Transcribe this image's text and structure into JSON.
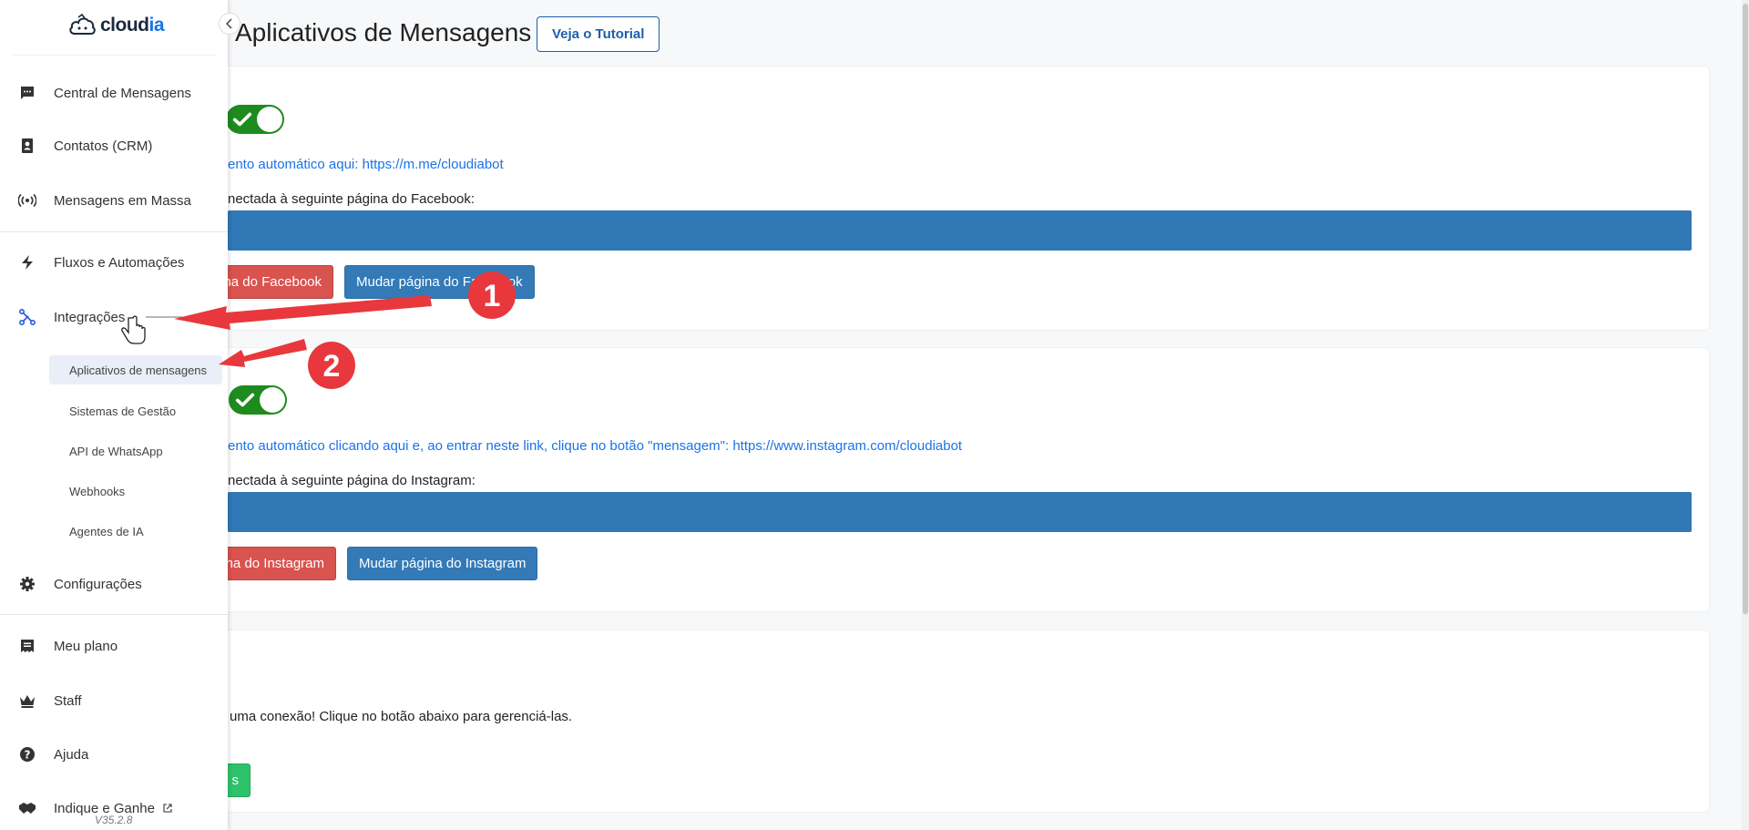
{
  "page": {
    "title": "Aplicativos de Mensagens",
    "tutorial_label": "Veja o Tutorial"
  },
  "facebook": {
    "link_text": "ento automático aqui: https://m.me/cloudiabot",
    "connected_label": "nectada à seguinte página do Facebook:",
    "remove_label": "na do Facebook",
    "change_label": "Mudar página do Facebook"
  },
  "instagram": {
    "link_text": "ento automático clicando aqui e, ao entrar neste link, clique no botão \"mensagem\": https://www.instagram.com/cloudiabot",
    "connected_label": "nectada à seguinte página do Instagram:",
    "remove_label": "na do Instagram",
    "change_label": "Mudar página do Instagram"
  },
  "third_card": {
    "text": "uma conexão! Clique no botão abaixo para gerenciá-las.",
    "button_label": "s"
  },
  "sidebar": {
    "logo_main": "cloud",
    "logo_accent": "ia",
    "items": [
      {
        "label": "Central de Mensagens",
        "icon": "chat-icon"
      },
      {
        "label": "Contatos (CRM)",
        "icon": "contact-icon"
      },
      {
        "label": "Mensagens em Massa",
        "icon": "broadcast-icon"
      },
      {
        "label": "Fluxos e Automações",
        "icon": "bolt-icon"
      },
      {
        "label": "Integrações",
        "icon": "integration-icon"
      },
      {
        "label": "Configurações",
        "icon": "gear-icon"
      },
      {
        "label": "Meu plano",
        "icon": "receipt-icon"
      },
      {
        "label": "Staff",
        "icon": "crown-icon"
      },
      {
        "label": "Ajuda",
        "icon": "help-icon"
      },
      {
        "label": "Indique e Ganhe",
        "icon": "handshake-icon"
      }
    ],
    "subitems": [
      {
        "label": "Aplicativos de mensagens"
      },
      {
        "label": "Sistemas de Gestão"
      },
      {
        "label": "API de WhatsApp"
      },
      {
        "label": "Webhooks"
      },
      {
        "label": "Agentes de IA"
      }
    ],
    "version": "V35.2.8"
  },
  "annotations": {
    "badge_1": "1",
    "badge_2": "2"
  },
  "colors": {
    "toggle_on": "#1e8b1e",
    "page_bar": "#3178b6",
    "danger": "#d9534f",
    "primary": "#337ab7",
    "success": "#2ec26a",
    "annotation_red": "#e8383d",
    "link": "#1a73e8"
  }
}
